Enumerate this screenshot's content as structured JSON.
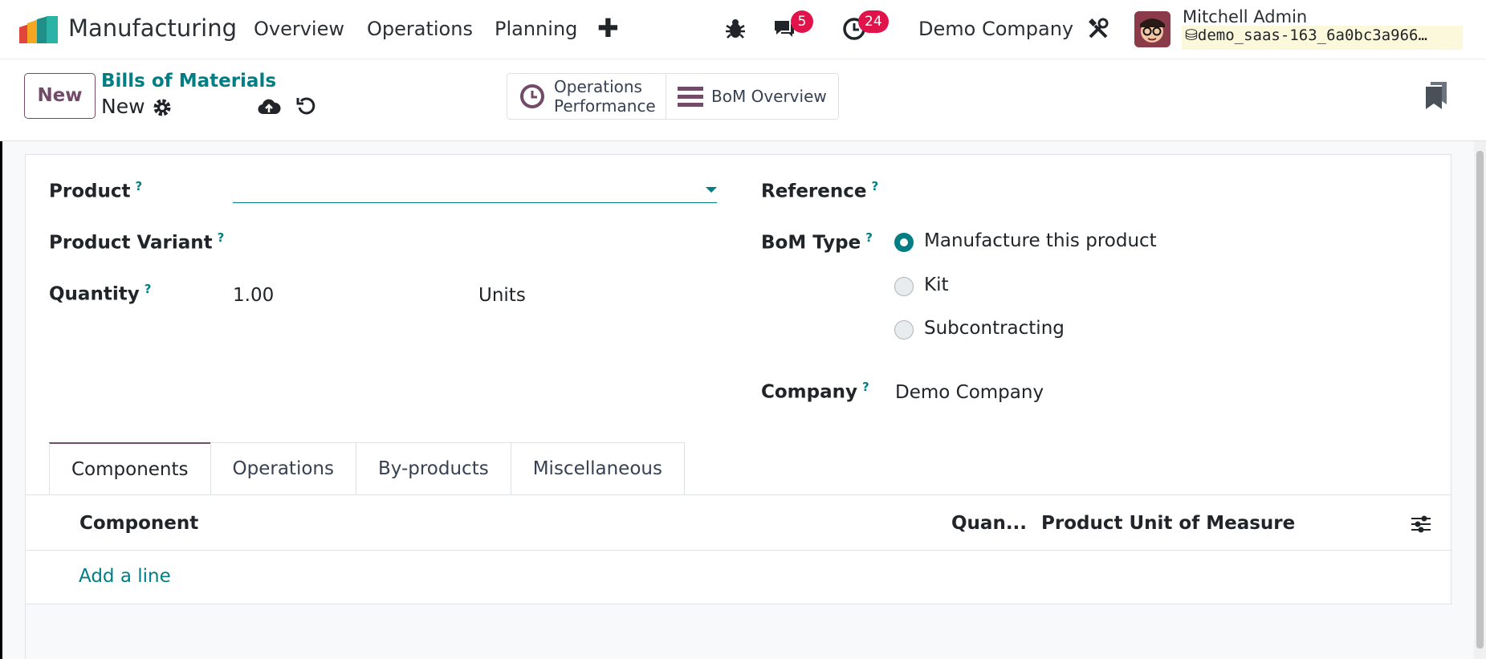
{
  "navbar": {
    "app_name": "Manufacturing",
    "menu": [
      "Overview",
      "Operations",
      "Planning"
    ],
    "new_item_icon": "plus-icon",
    "messages_count": "5",
    "activities_count": "24",
    "company": "Demo Company",
    "user_name": "Mitchell Admin",
    "database": "demo_saas-163_6a0bc3a966…"
  },
  "control": {
    "new_label": "New",
    "breadcrumb_parent": "Bills of Materials",
    "breadcrumb_current": "New",
    "smart_buttons": [
      "Operations Performance",
      "BoM Overview"
    ]
  },
  "form": {
    "product_label": "Product",
    "variant_label": "Product Variant",
    "quantity_label": "Quantity",
    "quantity_value": "1.00",
    "uom_value": "Units",
    "reference_label": "Reference",
    "bom_type_label": "BoM Type",
    "bom_type_options": [
      "Manufacture this product",
      "Kit",
      "Subcontracting"
    ],
    "bom_type_selected": "Manufacture this product",
    "company_label": "Company",
    "company_value": "Demo Company",
    "help_marker": "?"
  },
  "tabs": [
    "Components",
    "Operations",
    "By-products",
    "Miscellaneous"
  ],
  "active_tab": "Components",
  "components_table": {
    "columns": [
      "Component",
      "Quan...",
      "Product Unit of Measure"
    ],
    "add_line": "Add a line"
  },
  "colors": {
    "brand": "#714b67",
    "accent": "#017e84",
    "badge": "#e0134a"
  }
}
